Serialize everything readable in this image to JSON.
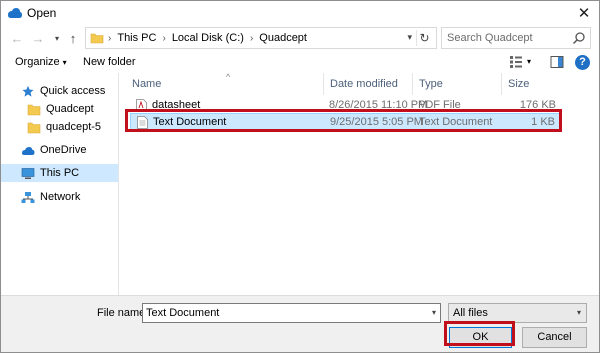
{
  "window": {
    "title": "Open"
  },
  "address": {
    "crumbs": [
      "This PC",
      "Local Disk (C:)",
      "Quadcept"
    ],
    "search_placeholder": "Search Quadcept"
  },
  "toolbar": {
    "organize": "Organize",
    "new_folder": "New folder",
    "help": "?"
  },
  "nav": {
    "items": [
      {
        "label": "Quick access"
      },
      {
        "label": "Quadcept"
      },
      {
        "label": "quadcept-5"
      },
      {
        "label": "OneDrive"
      },
      {
        "label": "This PC"
      },
      {
        "label": "Network"
      }
    ]
  },
  "files": {
    "columns": [
      "Name",
      "Date modified",
      "Type",
      "Size"
    ],
    "rows": [
      {
        "name": "datasheet",
        "date": "8/26/2015 11:10 PM",
        "type": "PDF File",
        "size": "176 KB"
      },
      {
        "name": "Text Document",
        "date": "9/25/2015 5:05 PM",
        "type": "Text Document",
        "size": "1 KB"
      }
    ]
  },
  "bottom": {
    "file_name_label": "File name:",
    "file_name_value": "Text Document",
    "file_type": "All files",
    "ok": "OK",
    "cancel": "Cancel"
  },
  "colors": {
    "selection": "#cce8ff",
    "highlight": "#c0101b",
    "accent": "#0078d7"
  }
}
